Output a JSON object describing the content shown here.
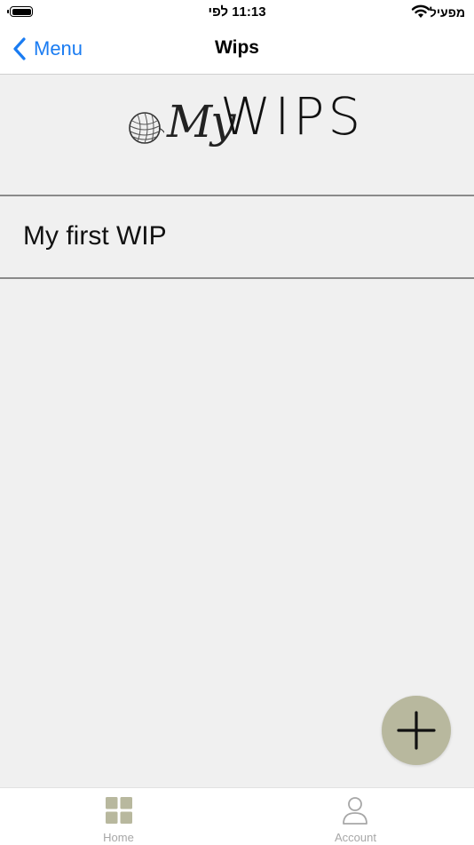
{
  "status_bar": {
    "time": "11:13 לפי",
    "carrier": "מפעיל"
  },
  "nav": {
    "back_label": "Menu",
    "title": "Wips"
  },
  "logo": {
    "script_text": "My",
    "main_text": "WIPS"
  },
  "list": {
    "items": [
      {
        "label": "My first WIP"
      }
    ]
  },
  "fab": {
    "icon": "plus-icon"
  },
  "tab_bar": {
    "tabs": [
      {
        "label": "Home",
        "icon": "grid-icon"
      },
      {
        "label": "Account",
        "icon": "person-icon"
      }
    ]
  },
  "colors": {
    "accent": "#1a7cf2",
    "fab": "#b8b89e",
    "tab_inactive": "#a7a7a7",
    "background": "#f0f0f0"
  }
}
